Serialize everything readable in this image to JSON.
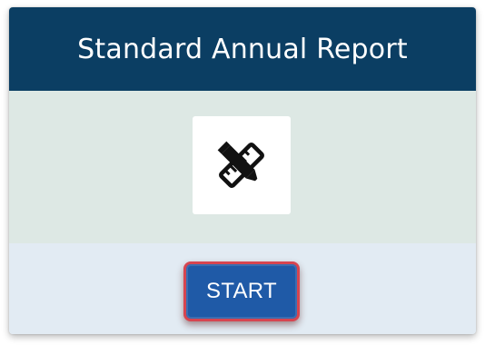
{
  "card": {
    "title": "Standard Annual Report",
    "icon": "ruler-pencil-icon",
    "button_label": "START"
  },
  "colors": {
    "header": "#0b3e63",
    "body": "#dde8e4",
    "footer": "#e2ebf3",
    "button": "#1f5aa7",
    "button_outline": "#d64550"
  }
}
